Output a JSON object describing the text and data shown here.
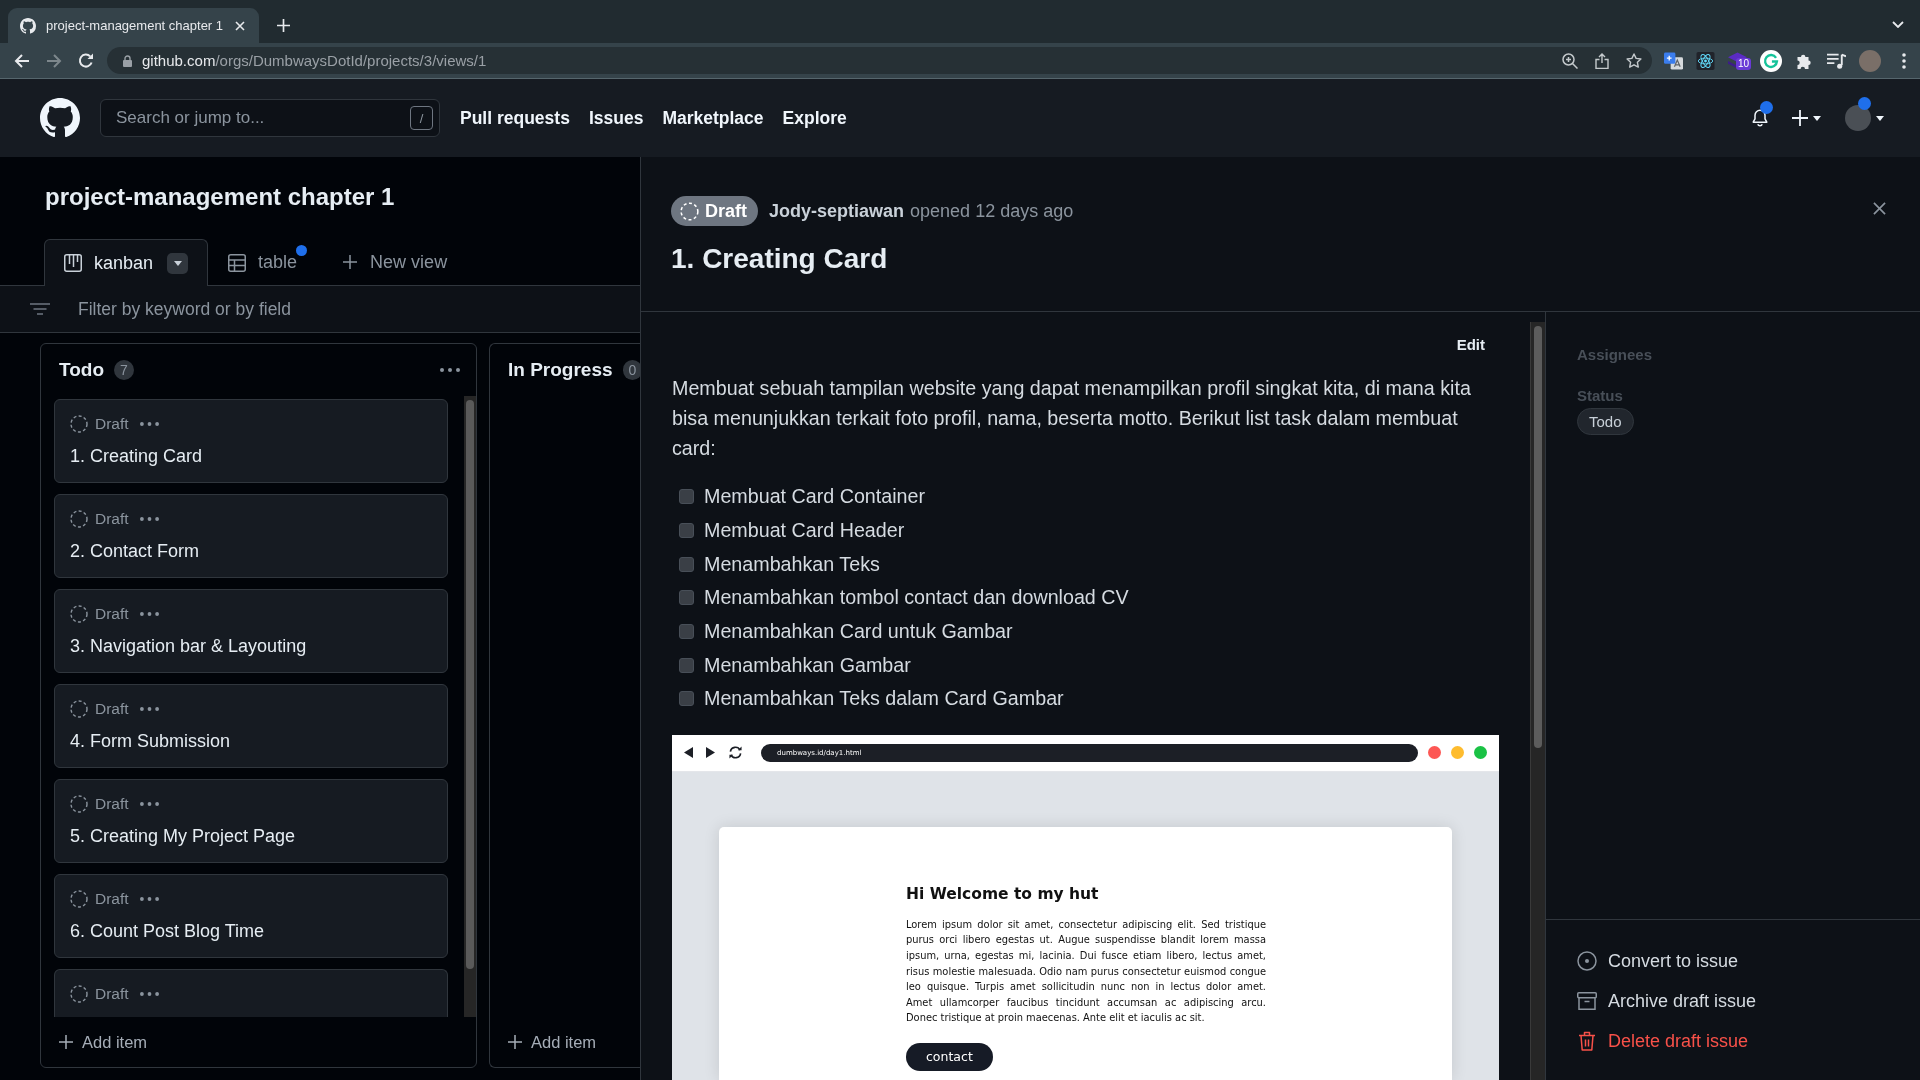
{
  "browser": {
    "tab_title": "project-management chapter 1",
    "url_host": "github.com",
    "url_path": "/orgs/DumbwaysDotId/projects/3/views/1",
    "extension_badge": "10"
  },
  "header": {
    "search": {
      "placeholder": "Search or jump to...",
      "shortcut": "/"
    },
    "nav": [
      "Pull requests",
      "Issues",
      "Marketplace",
      "Explore"
    ],
    "notifications_unread": true,
    "profile_dot": true
  },
  "project": {
    "title": "project-management chapter 1",
    "views": [
      {
        "label": "kanban",
        "kind": "board",
        "selected": true,
        "unsaved": false
      },
      {
        "label": "table",
        "kind": "table",
        "selected": false,
        "unsaved": true
      }
    ],
    "new_view": "New view",
    "filter": {
      "placeholder": "Filter by keyword or by field"
    }
  },
  "columns": [
    {
      "name": "Todo",
      "count": "7",
      "cards": [
        {
          "status": "Draft",
          "title": "1. Creating Card"
        },
        {
          "status": "Draft",
          "title": "2. Contact Form"
        },
        {
          "status": "Draft",
          "title": "3. Navigation bar & Layouting"
        },
        {
          "status": "Draft",
          "title": "4. Form Submission"
        },
        {
          "status": "Draft",
          "title": "5. Creating My Project Page"
        },
        {
          "status": "Draft",
          "title": "6. Count Post Blog Time"
        },
        {
          "status": "Draft"
        }
      ],
      "add_item": "Add item"
    },
    {
      "name": "In Progress",
      "count": "0",
      "add_item": "Add item"
    }
  ],
  "detail": {
    "state": {
      "label": "Draft",
      "kind": "draft"
    },
    "author": "Jody-septiawan",
    "opened": "opened 12 days ago",
    "title": "1. Creating Card",
    "edit": "Edit",
    "description": "Membuat sebuah tampilan website yang dapat menampilkan profil singkat kita, di mana kita bisa menunjukkan terkait foto profil, nama, beserta motto. Berikut list task dalam membuat card:",
    "tasks": [
      {
        "label": "Membuat Card Container",
        "checked": false
      },
      {
        "label": "Membuat Card Header",
        "checked": false
      },
      {
        "label": "Menambahkan Teks",
        "checked": false
      },
      {
        "label": "Menambahkan tombol contact dan download CV",
        "checked": false
      },
      {
        "label": "Menambahkan Card untuk Gambar",
        "checked": false
      },
      {
        "label": "Menambahkan Gambar",
        "checked": false
      },
      {
        "label": "Menambahkan Teks dalam Card Gambar",
        "checked": false
      }
    ],
    "attachment": {
      "url": "dumbways.id/day1.html",
      "heading": "Hi Welcome to my hut",
      "body": "Lorem ipsum dolor sit amet, consectetur adipiscing elit. Sed tristique purus orci libero egestas ut. Augue suspendisse blandit lorem massa ipsum, urna, egestas mi, lacinia. Dui fusce etiam libero, lectus amet, risus molestie malesuada. Odio nam purus consectetur euismod congue leo quisque. Turpis amet sollicitudin nunc non in lectus dolor amet. Amet ullamcorper faucibus tincidunt accumsan ac adipiscing arcu. Donec tristique at proin maecenas. Ante elit et iaculis ac sit.",
      "button": "contact"
    }
  },
  "sidebar": {
    "fields": [
      {
        "label": "Assignees"
      },
      {
        "label": "Status",
        "value": "Todo"
      }
    ],
    "actions": [
      {
        "label": "Convert to issue",
        "kind": "convert"
      },
      {
        "label": "Archive draft issue",
        "kind": "archive"
      },
      {
        "label": "Delete draft issue",
        "kind": "delete"
      }
    ]
  }
}
